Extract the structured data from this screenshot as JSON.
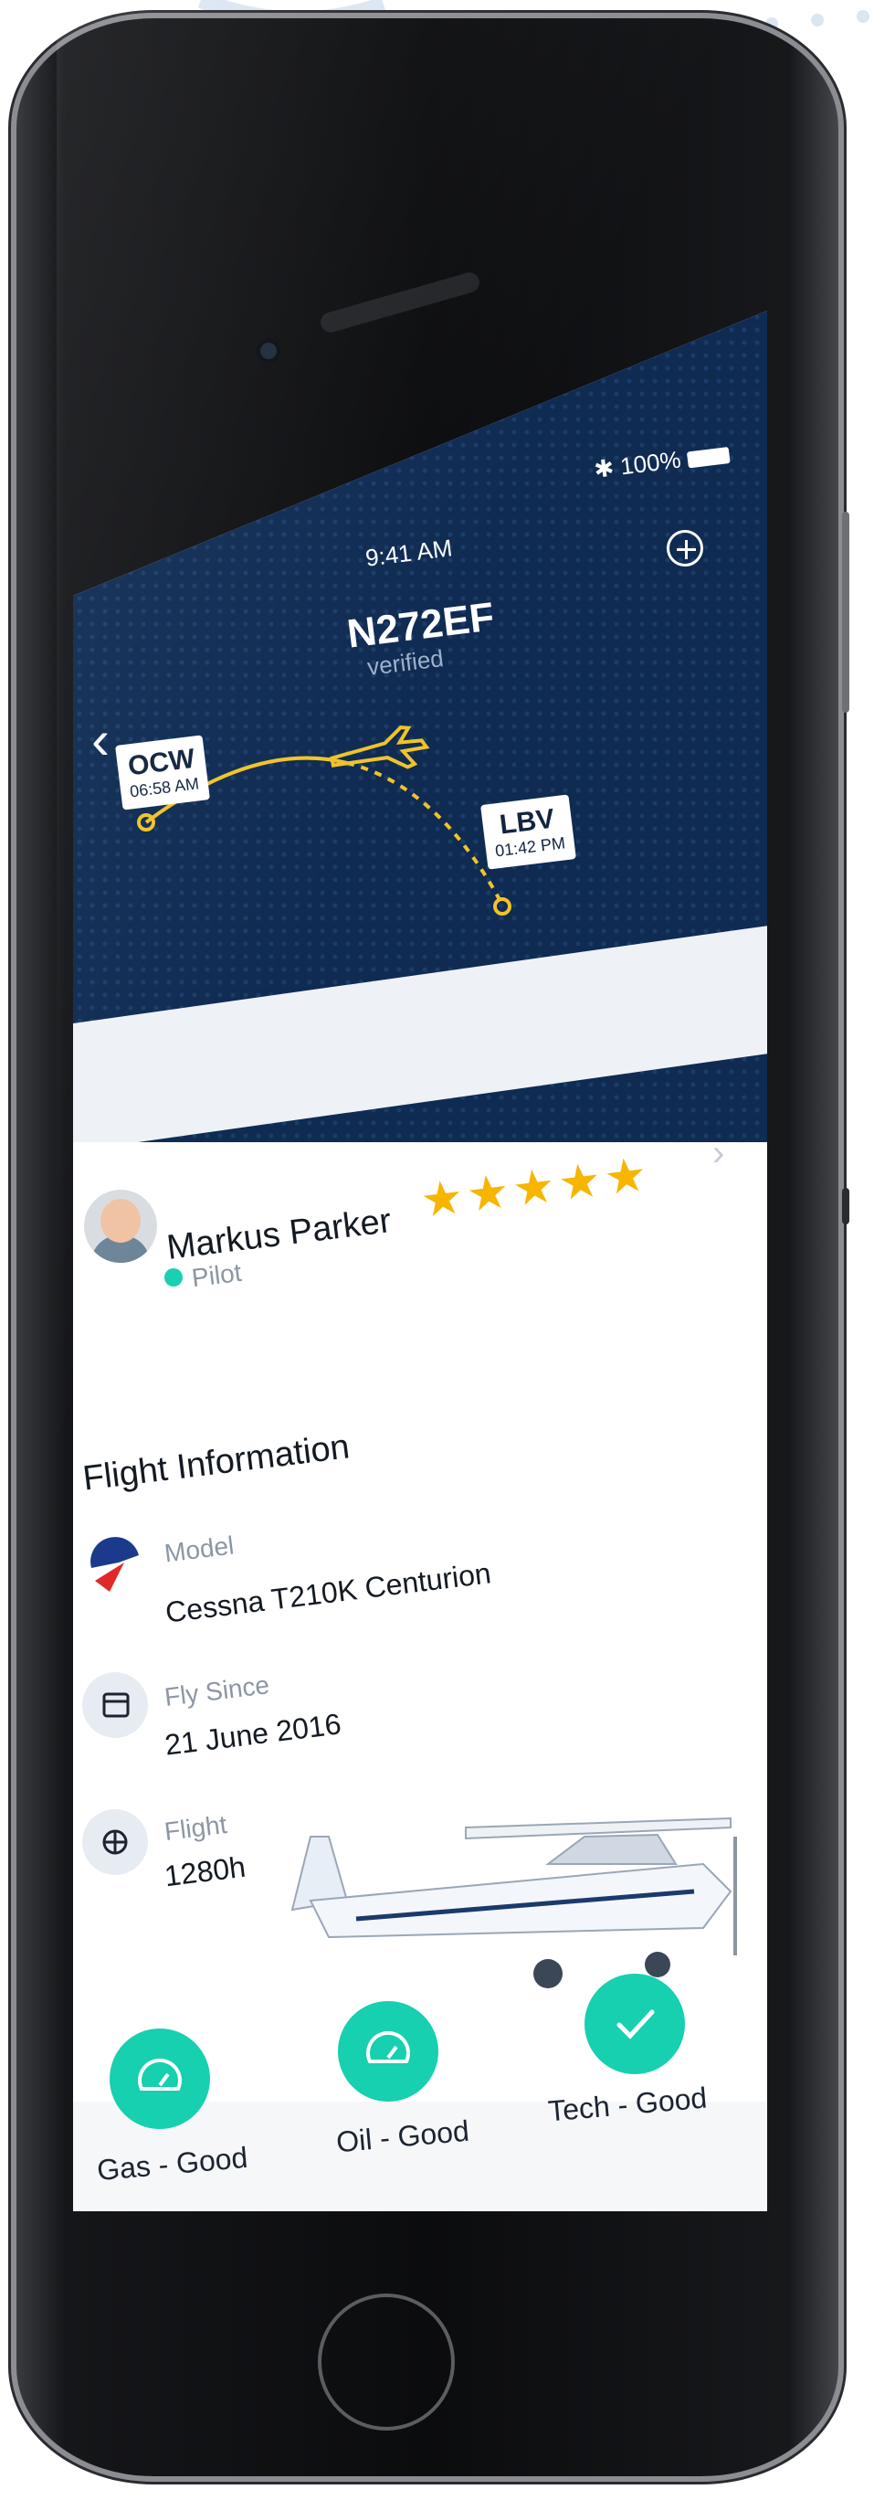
{
  "status": {
    "time": "9:41 AM",
    "battery": "100%"
  },
  "header": {
    "title": "N272EF",
    "subtitle": "verified"
  },
  "route": {
    "from": {
      "code": "OCW",
      "time": "06:58 AM"
    },
    "to": {
      "code": "LBV",
      "time": "01:42 PM"
    }
  },
  "pilot": {
    "name": "Markus Parker",
    "role": "Pilot",
    "rating": 5,
    "stars": "★★★★★"
  },
  "flight_info": {
    "title": "Flight Information",
    "items": [
      {
        "label": "Model",
        "value": "Cessna T210K Centurion",
        "icon": "airline-logo-icon"
      },
      {
        "label": "Fly Since",
        "value": "21 June 2016",
        "icon": "calendar-icon"
      },
      {
        "label": "Flight",
        "value": "1280h",
        "icon": "propeller-icon"
      }
    ]
  },
  "checks": [
    {
      "label": "Gas - Good",
      "icon": "gauge-icon"
    },
    {
      "label": "Oil - Good",
      "icon": "gauge-icon"
    },
    {
      "label": "Tech - Good",
      "icon": "check-icon"
    }
  ],
  "colors": {
    "hero": "#0f2b52",
    "accent": "#16d0b0",
    "star": "#f7b500",
    "route": "#f0c329"
  }
}
